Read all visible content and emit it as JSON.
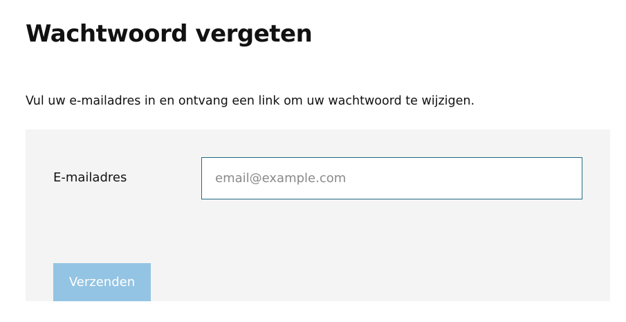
{
  "page": {
    "title": "Wachtwoord vergeten",
    "intro": "Vul uw e-mailadres in en ontvang een link om uw wachtwoord te wijzigen."
  },
  "form": {
    "email_label": "E-mailadres",
    "email_value": "",
    "email_placeholder": "email@example.com",
    "submit_label": "Verzenden",
    "submit_state": "disabled"
  },
  "colors": {
    "panel_background": "#f4f4f4",
    "input_border": "#1f6b82",
    "button_background": "#94c4e3",
    "button_text": "#ffffff"
  }
}
